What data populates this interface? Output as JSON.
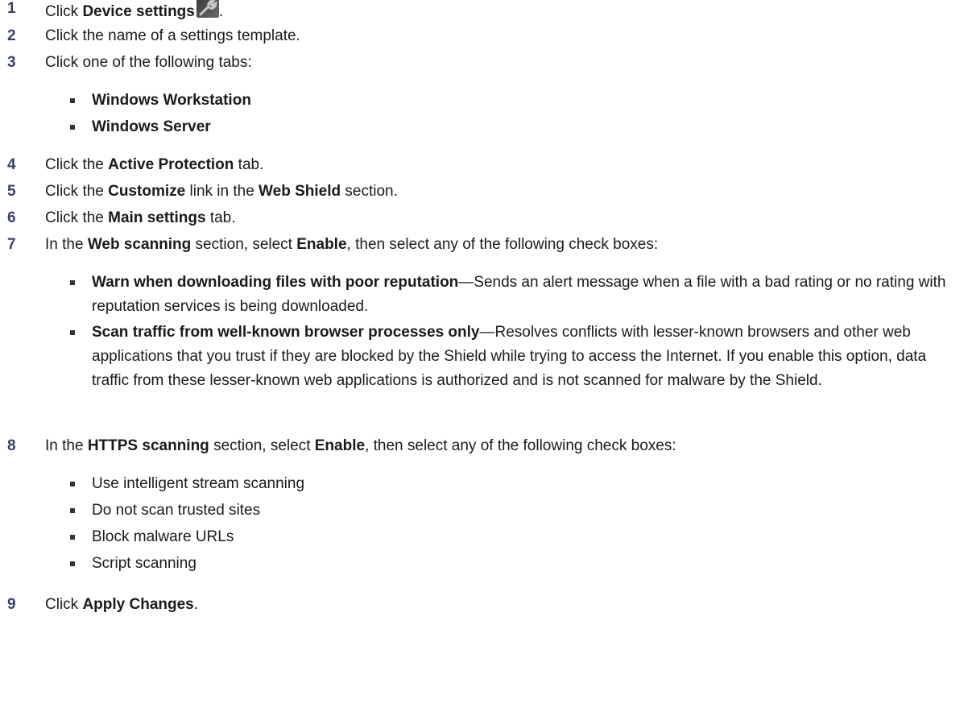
{
  "steps": [
    {
      "num": "1",
      "parts": [
        {
          "t": "Click ",
          "b": false
        },
        {
          "t": "Device settings",
          "b": true
        }
      ],
      "icon": "wrench-icon",
      "after_icon": "."
    },
    {
      "num": "2",
      "parts": [
        {
          "t": "Click the name of a settings template.",
          "b": false
        }
      ]
    },
    {
      "num": "3",
      "parts": [
        {
          "t": "Click one of the following tabs:",
          "b": false
        }
      ]
    },
    {
      "num": "4",
      "parts": [
        {
          "t": "Click the ",
          "b": false
        },
        {
          "t": "Active Protection",
          "b": true
        },
        {
          "t": " tab.",
          "b": false
        }
      ]
    },
    {
      "num": "5",
      "parts": [
        {
          "t": "Click the ",
          "b": false
        },
        {
          "t": "Customize",
          "b": true
        },
        {
          "t": " link in the ",
          "b": false
        },
        {
          "t": "Web Shield",
          "b": true
        },
        {
          "t": " section.",
          "b": false
        }
      ]
    },
    {
      "num": "6",
      "parts": [
        {
          "t": "Click the ",
          "b": false
        },
        {
          "t": "Main settings",
          "b": true
        },
        {
          "t": " tab.",
          "b": false
        }
      ]
    },
    {
      "num": "7",
      "parts": [
        {
          "t": "In the ",
          "b": false
        },
        {
          "t": "Web scanning",
          "b": true
        },
        {
          "t": " section, select ",
          "b": false
        },
        {
          "t": "Enable",
          "b": true
        },
        {
          "t": ", then select any of the following check boxes:",
          "b": false
        }
      ]
    },
    {
      "num": "8",
      "parts": [
        {
          "t": "In the ",
          "b": false
        },
        {
          "t": "HTTPS scanning",
          "b": true
        },
        {
          "t": " section, select ",
          "b": false
        },
        {
          "t": "Enable",
          "b": true
        },
        {
          "t": ", then select any of the following check boxes:",
          "b": false
        }
      ]
    },
    {
      "num": "9",
      "parts": [
        {
          "t": "Click ",
          "b": false
        },
        {
          "t": "Apply Changes",
          "b": true
        },
        {
          "t": ".",
          "b": false
        }
      ]
    }
  ],
  "step3_bullets": [
    {
      "bold": "Windows Workstation",
      "rest": ""
    },
    {
      "bold": "Windows Server",
      "rest": ""
    }
  ],
  "step7_bullets": [
    {
      "bold": "Warn when downloading files with poor reputation",
      "rest": "—Sends an alert message when a file with a bad rating or no rating with reputation services is being downloaded."
    },
    {
      "bold": "Scan traffic from well-known browser processes only",
      "rest": "—Resolves conflicts with lesser-known browsers and other web applications that you trust if they are blocked by the Shield while trying to access the Internet. If you enable this option, data traffic from these lesser-known web applications is authorized and is not scanned for malware by the Shield."
    }
  ],
  "step8_bullets": [
    {
      "bold": "",
      "rest": "Use intelligent stream scanning"
    },
    {
      "bold": "",
      "rest": "Do not scan trusted sites"
    },
    {
      "bold": "",
      "rest": "Block malware URLs"
    },
    {
      "bold": "",
      "rest": "Script scanning"
    }
  ]
}
